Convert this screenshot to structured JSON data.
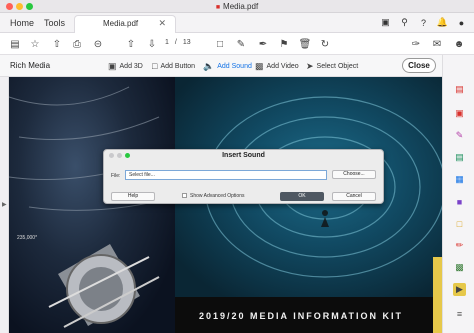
{
  "window": {
    "title": "Media.pdf"
  },
  "tabs": {
    "home": "Home",
    "tools": "Tools",
    "document": "Media.pdf"
  },
  "toolbar": {
    "page_current": "1",
    "page_sep": "/",
    "page_total": "13"
  },
  "rich_media": {
    "title": "Rich Media",
    "buttons": [
      "Add 3D",
      "Add Button",
      "Add Sound",
      "Add Video",
      "Select Object"
    ],
    "active": "Add Sound",
    "close_label": "Close"
  },
  "document": {
    "distance_label": "235,000*",
    "kit_title": "2019/20 MEDIA INFORMATION KIT"
  },
  "dialog": {
    "title": "Insert Sound",
    "file_label": "File:",
    "file_value": "Select file...",
    "choose_label": "Choose...",
    "help_label": "Help",
    "advanced_label": "Show Advanced Options",
    "ok_label": "OK",
    "cancel_label": "Cancel"
  },
  "colors": {
    "accent": "#1473e6",
    "rail_active": "#e6c84a"
  }
}
